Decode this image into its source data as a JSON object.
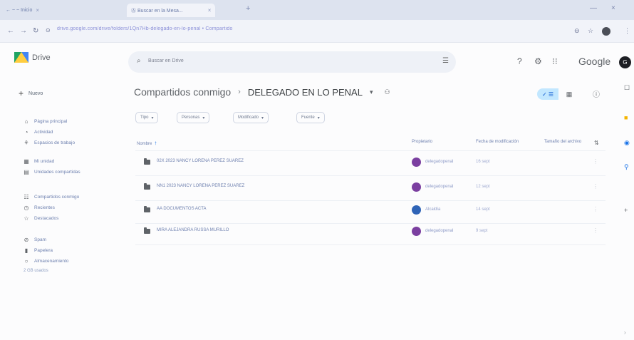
{
  "browser": {
    "tabs": [
      {
        "label": "← ~ ~ Inicio",
        "active": false
      },
      {
        "label": "Ⓐ Buscar en la Mesa...",
        "active": true
      }
    ],
    "url": "drive.google.com/drive/folders/1Qn7Hb-delegado-en-lo-penal • Compartido",
    "new_tab": "+",
    "min": "—",
    "close": "×"
  },
  "drive": {
    "logo_text": "Drive",
    "search_placeholder": "Buscar en Drive",
    "brand": "Google",
    "avatar_letter": "G"
  },
  "sidebar": {
    "new_label": "Nuevo",
    "items": [
      {
        "label": "Página principal",
        "icon": "home-icon"
      },
      {
        "label": "Actividad",
        "icon": "activity-icon"
      },
      {
        "label": "Espacios de trabajo",
        "icon": "workspaces-icon"
      },
      {
        "label": "Mi unidad",
        "icon": "my-drive-icon"
      },
      {
        "label": "Unidades compartidas",
        "icon": "shared-drives-icon"
      },
      {
        "label": "Compartidos conmigo",
        "icon": "shared-with-me-icon"
      },
      {
        "label": "Recientes",
        "icon": "recent-icon"
      },
      {
        "label": "Destacados",
        "icon": "starred-icon"
      },
      {
        "label": "Spam",
        "icon": "spam-icon"
      },
      {
        "label": "Papelera",
        "icon": "trash-icon"
      },
      {
        "label": "Almacenamiento",
        "icon": "cloud-icon"
      }
    ],
    "storage_text": "2 GB usados"
  },
  "main": {
    "breadcrumb_parent": "Compartidos conmigo",
    "breadcrumb_sep": "›",
    "breadcrumb_current": "DELEGADO EN LO PENAL",
    "breadcrumb_caret": "▾",
    "filters": [
      "Tipo",
      "Personas",
      "Modificado",
      "Fuente"
    ],
    "columns": {
      "name": "Nombre",
      "owner": "Propietario",
      "modified": "Fecha de modificación",
      "size": "Tamaño del archivo"
    },
    "rows": [
      {
        "name": "02X 2023 NANCY LORENA PEREZ SUAREZ",
        "owner": "delegadopenal",
        "owner_color": "#7b3fa0",
        "modified": "16 sept"
      },
      {
        "name": "NN1 2023 NANCY LORENA PEREZ SUAREZ",
        "owner": "delegadopenal",
        "owner_color": "#7b3fa0",
        "modified": "12 sept"
      },
      {
        "name": "AA DOCUMENTOS ACTA",
        "owner": "Alcaldía",
        "owner_color": "#2f64b7",
        "modified": "14 sept"
      },
      {
        "name": "MIRA ALEJANDRA RUSSA MURILLO",
        "owner": "delegadopenal",
        "owner_color": "#7b3fa0",
        "modified": "9 sept"
      }
    ]
  }
}
